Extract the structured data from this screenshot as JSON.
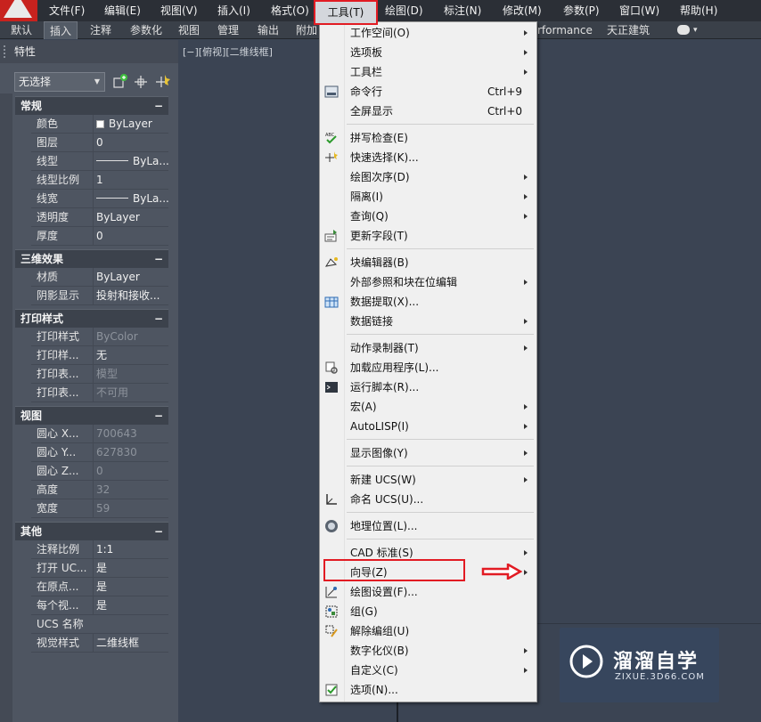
{
  "menubar": {
    "items": [
      "文件(F)",
      "编辑(E)",
      "视图(V)",
      "插入(I)",
      "格式(O)",
      "工具(T)",
      "绘图(D)",
      "标注(N)",
      "修改(M)",
      "参数(P)",
      "窗口(W)",
      "帮助(H)"
    ]
  },
  "ribbon": {
    "tabs": [
      "默认",
      "插入",
      "注释",
      "参数化",
      "视图",
      "管理",
      "输出",
      "附加"
    ],
    "extra": "rformance",
    "extra2": "天正建筑"
  },
  "panel": {
    "title": "特性",
    "selection": "无选择",
    "sections": [
      {
        "label": "常规",
        "collapse": "−"
      },
      {
        "label": "三维效果",
        "collapse": "−"
      },
      {
        "label": "打印样式",
        "collapse": "−"
      },
      {
        "label": "视图",
        "collapse": "−"
      },
      {
        "label": "其他",
        "collapse": "−"
      }
    ],
    "general": [
      {
        "key": "颜色",
        "value": "ByLayer"
      },
      {
        "key": "图层",
        "value": "0"
      },
      {
        "key": "线型",
        "value": "ByLa..."
      },
      {
        "key": "线型比例",
        "value": "1"
      },
      {
        "key": "线宽",
        "value": "ByLa..."
      },
      {
        "key": "透明度",
        "value": "ByLayer"
      },
      {
        "key": "厚度",
        "value": "0"
      }
    ],
    "effects3d": [
      {
        "key": "材质",
        "value": "ByLayer"
      },
      {
        "key": "阴影显示",
        "value": "投射和接收..."
      }
    ],
    "plotstyle": [
      {
        "key": "打印样式",
        "value": "ByColor"
      },
      {
        "key": "打印样...",
        "value": "无"
      },
      {
        "key": "打印表...",
        "value": "模型"
      },
      {
        "key": "打印表...",
        "value": "不可用"
      }
    ],
    "view": [
      {
        "key": "圆心 X...",
        "value": "700643"
      },
      {
        "key": "圆心 Y...",
        "value": "627830"
      },
      {
        "key": "圆心 Z...",
        "value": "0"
      },
      {
        "key": "高度",
        "value": "32"
      },
      {
        "key": "宽度",
        "value": "59"
      }
    ],
    "misc": [
      {
        "key": "注释比例",
        "value": "1:1"
      },
      {
        "key": "打开 UC...",
        "value": "是"
      },
      {
        "key": "在原点...",
        "value": "是"
      },
      {
        "key": "每个视...",
        "value": "是"
      },
      {
        "key": "UCS 名称",
        "value": ""
      },
      {
        "key": "视觉样式",
        "value": "二维线框"
      }
    ]
  },
  "viewport": {
    "label": "[−][俯视][二维线框]"
  },
  "dropdown": {
    "items": [
      {
        "label": "工作空间(O)"
      },
      {
        "label": "选项板"
      },
      {
        "label": "工具栏"
      },
      {
        "label": "命令行",
        "shortcut": "Ctrl+9"
      },
      {
        "label": "全屏显示",
        "shortcut": "Ctrl+0"
      },
      {
        "label": "拼写检查(E)"
      },
      {
        "label": "快速选择(K)..."
      },
      {
        "label": "绘图次序(D)"
      },
      {
        "label": "隔离(I)"
      },
      {
        "label": "查询(Q)"
      },
      {
        "label": "更新字段(T)"
      },
      {
        "label": "块编辑器(B)"
      },
      {
        "label": "外部参照和块在位编辑"
      },
      {
        "label": "数据提取(X)..."
      },
      {
        "label": "数据链接"
      },
      {
        "label": "动作录制器(T)"
      },
      {
        "label": "加载应用程序(L)..."
      },
      {
        "label": "运行脚本(R)..."
      },
      {
        "label": "宏(A)"
      },
      {
        "label": "AutoLISP(I)"
      },
      {
        "label": "显示图像(Y)"
      },
      {
        "label": "新建 UCS(W)"
      },
      {
        "label": "命名 UCS(U)..."
      },
      {
        "label": "地理位置(L)..."
      },
      {
        "label": "CAD 标准(S)"
      },
      {
        "label": "向导(Z)"
      },
      {
        "label": "绘图设置(F)..."
      },
      {
        "label": "组(G)"
      },
      {
        "label": "解除编组(U)"
      },
      {
        "label": "数字化仪(B)"
      },
      {
        "label": "自定义(C)"
      },
      {
        "label": "选项(N)..."
      }
    ]
  },
  "watermark": {
    "title": "溜溜自学",
    "subtitle": "ZIXUE.3D66.COM"
  },
  "colors": {
    "highlight": "#e21b23",
    "menu_bg": "#f0f0f0",
    "panel_bg": "#4e5561",
    "canvas_bg": "#3b4453"
  }
}
